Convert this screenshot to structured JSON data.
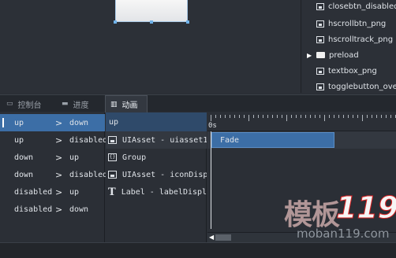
{
  "design_area": {},
  "assets": {
    "items": [
      {
        "label": "closebtn_disabled",
        "kind": "image"
      },
      {
        "label": "hscrollbtn_png",
        "kind": "image"
      },
      {
        "label": "hscrolltrack_png",
        "kind": "image"
      },
      {
        "label": "preload",
        "kind": "folder"
      },
      {
        "label": "textbox_png",
        "kind": "image"
      },
      {
        "label": "togglebutton_over",
        "kind": "image"
      }
    ]
  },
  "tabs": [
    {
      "label": "控制台",
      "icon": "console-icon"
    },
    {
      "label": "进度",
      "icon": "progress-icon"
    },
    {
      "label": "动画",
      "icon": "animation-icon",
      "active": true
    }
  ],
  "states": {
    "rows": [
      {
        "from": "up",
        "to": "down",
        "selected": true
      },
      {
        "from": "up",
        "to": "disabled"
      },
      {
        "from": "down",
        "to": "up"
      },
      {
        "from": "down",
        "to": "disabled"
      },
      {
        "from": "disabled",
        "to": "up"
      },
      {
        "from": "disabled",
        "to": "down"
      }
    ]
  },
  "targets": {
    "header": "up",
    "rows": [
      {
        "label": "UIAsset - uiasset1",
        "icon": "image-asset-icon"
      },
      {
        "label": "Group",
        "icon": "group-icon"
      },
      {
        "label": "UIAsset - iconDisplay",
        "icon": "image-asset-icon"
      },
      {
        "label": "Label - labelDisplay",
        "icon": "text-label-icon"
      }
    ]
  },
  "timeline": {
    "start_label": "0s",
    "effect": "Fade"
  },
  "watermark": {
    "brand": "模板",
    "number": "119",
    "url": "moban119.com"
  },
  "colors": {
    "selection": "#3c6ea6",
    "header": "#2f4a6a",
    "panel": "#2b2f36"
  }
}
